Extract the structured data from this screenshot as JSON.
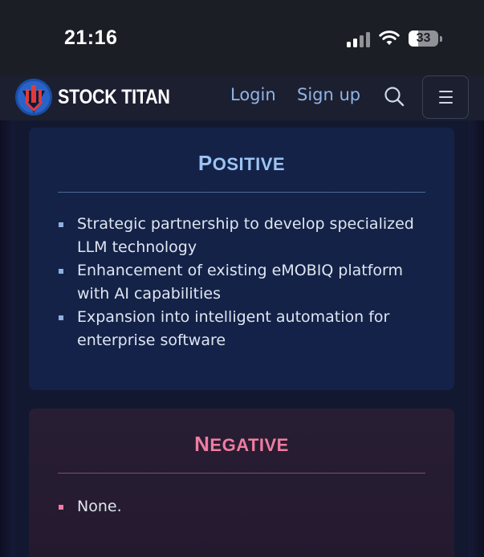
{
  "status_bar": {
    "time": "21:16",
    "battery_level": "33",
    "icons": [
      "cellular-signal-icon",
      "wifi-icon",
      "battery-icon"
    ]
  },
  "navbar": {
    "brand": "STOCK TITAN",
    "login": "Login",
    "signup": "Sign up",
    "icons": [
      "logo-icon",
      "search-icon",
      "hamburger-menu-icon"
    ]
  },
  "positive": {
    "title_initial": "P",
    "title_rest": "OSITIVE",
    "items": [
      "Strategic partnership to develop specialized LLM technology",
      "Enhancement of existing eMOBIQ platform with AI capabilities",
      "Expansion into intelligent automation for enterprise software"
    ]
  },
  "negative": {
    "title_initial": "N",
    "title_rest": "EGATIVE",
    "items": [
      "None."
    ]
  },
  "colors": {
    "positive_accent": "#9cc4f4",
    "negative_accent": "#f07ca0",
    "link": "#8fb4e6"
  }
}
